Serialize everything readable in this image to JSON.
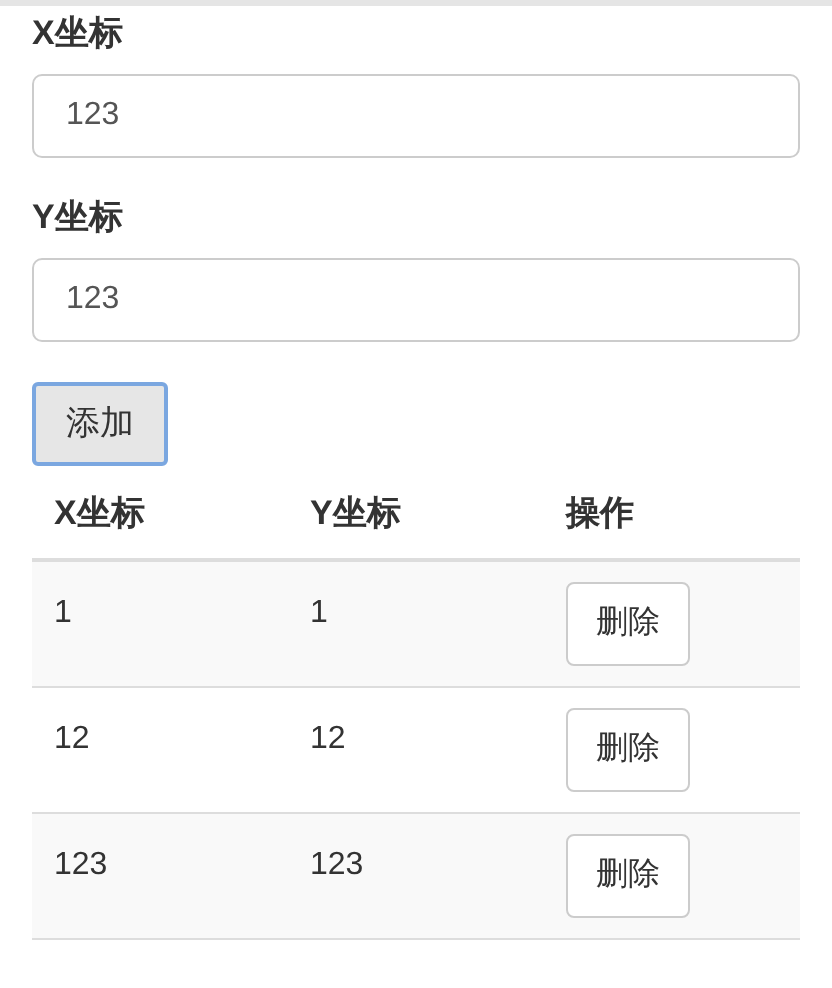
{
  "fields": [
    {
      "label": "X坐标",
      "value": "123"
    },
    {
      "label": "Y坐标",
      "value": "123"
    }
  ],
  "add_button": "添加",
  "table": {
    "columns": [
      "X坐标",
      "Y坐标",
      "操作"
    ],
    "rows": [
      {
        "cells": [
          "1",
          "1"
        ],
        "action": "删除"
      },
      {
        "cells": [
          "12",
          "12"
        ],
        "action": "删除"
      },
      {
        "cells": [
          "123",
          "123"
        ],
        "action": "删除"
      }
    ]
  }
}
